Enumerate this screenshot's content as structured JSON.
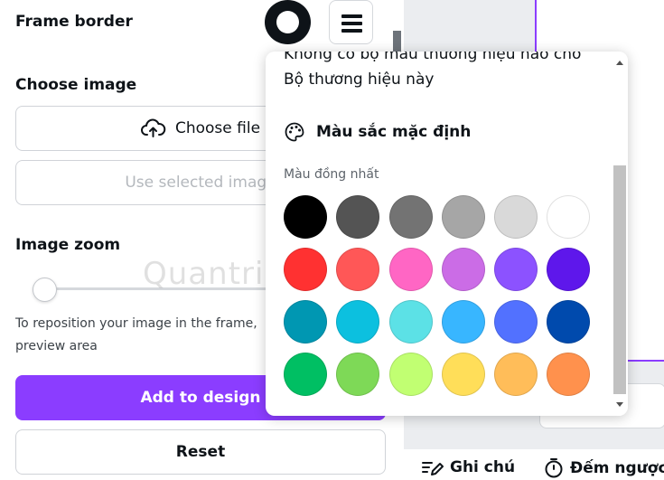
{
  "left_panel": {
    "frame_border_label": "Frame border",
    "choose_image_label": "Choose image",
    "choose_file_button": "Choose file",
    "use_selected_image_button": "Use selected image",
    "image_zoom_label": "Image zoom",
    "zoom_level": 0,
    "help_text": "To reposition your image in the frame, preview area",
    "add_to_design_button": "Add to design",
    "reset_button": "Reset",
    "watermark": "Quantrimang"
  },
  "bottom_bar": {
    "notes_label": "Ghi chú",
    "timer_label": "Đếm ngược"
  },
  "color_popover": {
    "cut_text": "Không có bộ màu thương hiệu nào cho",
    "brand_text": "Bộ thương hiệu này",
    "default_colors_heading": "Màu sắc mặc định",
    "solid_colors_label": "Màu đồng nhất",
    "swatches": [
      "#000000",
      "#545454",
      "#737373",
      "#a6a6a6",
      "#d9d9d9",
      "#ffffff",
      "#ff3131",
      "#ff5757",
      "#ff66c4",
      "#cb6ce6",
      "#8c52ff",
      "#5e17eb",
      "#0097b2",
      "#0cc0df",
      "#5ce1e6",
      "#38b6ff",
      "#5271ff",
      "#004aad",
      "#00bf63",
      "#7ed957",
      "#c1ff72",
      "#ffde59",
      "#ffbd59",
      "#ff914d"
    ]
  },
  "colors": {
    "accent": "#8b3dff"
  }
}
